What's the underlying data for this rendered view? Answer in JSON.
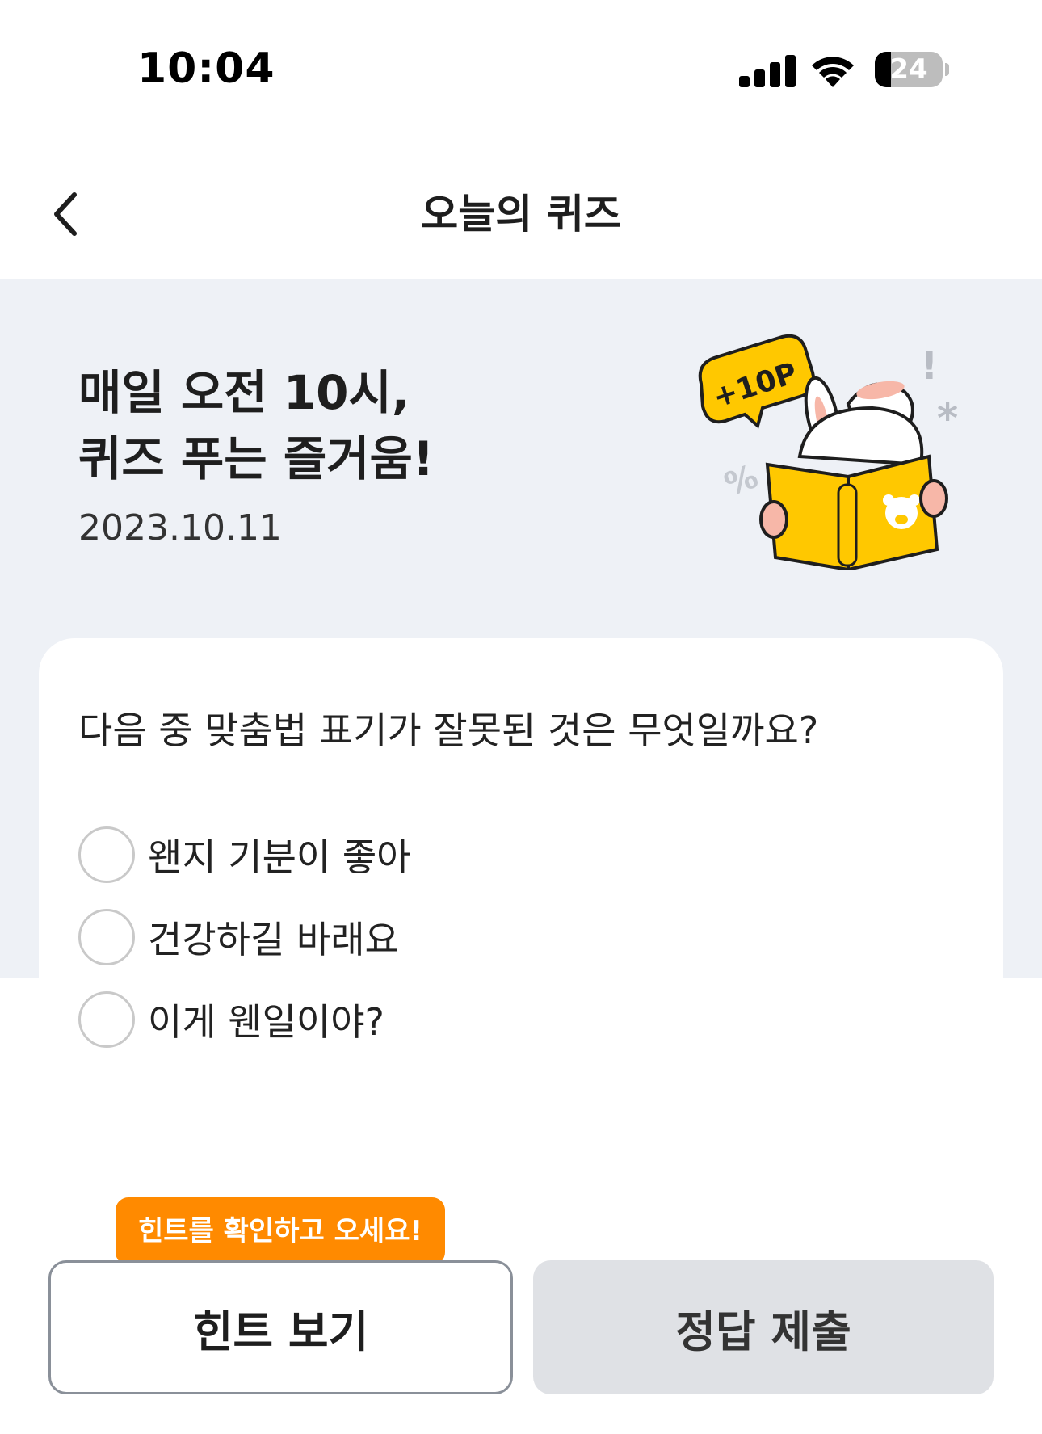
{
  "status_bar": {
    "time": "10:04",
    "battery_level": "24",
    "battery_fraction": 0.24,
    "icons": [
      "signal-icon",
      "wifi-icon",
      "battery-icon"
    ]
  },
  "nav": {
    "title": "오늘의 퀴즈",
    "back_icon": "chevron-left-icon"
  },
  "hero": {
    "title_line1": "매일 오전 10시,",
    "title_line2": "퀴즈 푸는 즐거움!",
    "date": "2023.10.11",
    "illustration": {
      "badge_text": "+10P",
      "description_icon": "bunny-reading-book-illustration"
    }
  },
  "quiz": {
    "question": "다음 중 맞춤법 표기가 잘못된 것은 무엇일까요?",
    "options": [
      {
        "label": "왠지 기분이 좋아",
        "selected": false
      },
      {
        "label": "건강하길 바래요",
        "selected": false
      },
      {
        "label": "이게 웬일이야?",
        "selected": false
      }
    ]
  },
  "actions": {
    "tooltip": "힌트를 확인하고 오세요!",
    "hint_button": "힌트 보기",
    "submit_button": "정답 제출"
  },
  "colors": {
    "accent_orange": "#ff8a00",
    "book_yellow": "#ffc800",
    "hero_bg": "#eef1f6",
    "submit_bg": "#dfe1e5"
  }
}
